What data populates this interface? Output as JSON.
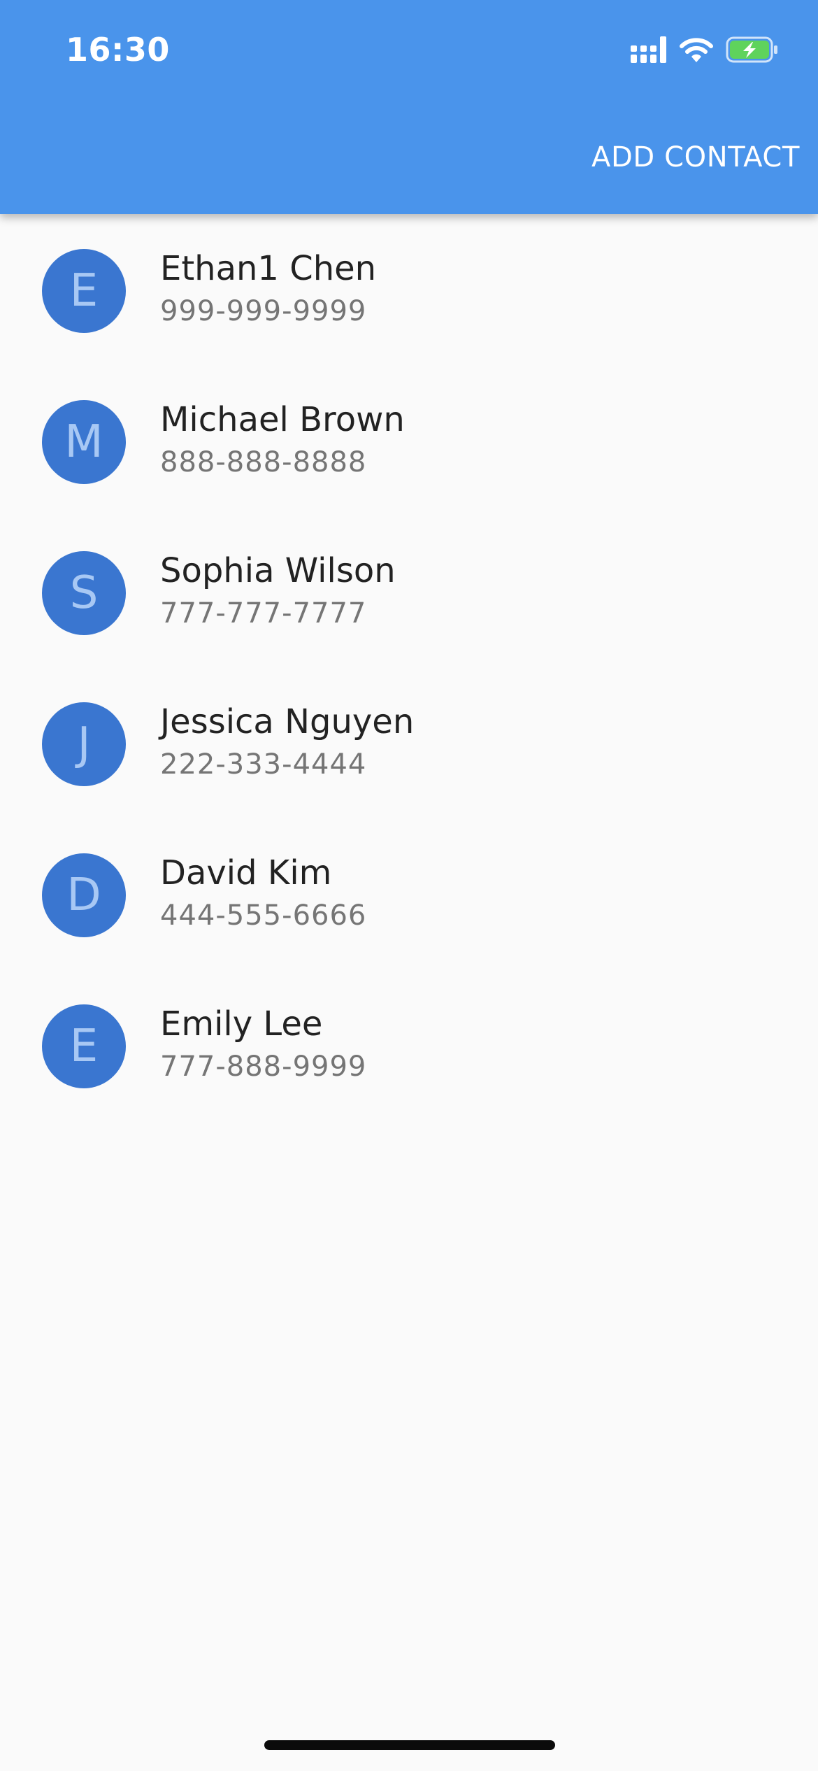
{
  "status_bar": {
    "time": "16:30",
    "icons": [
      "cellular-signal-icon",
      "wifi-icon",
      "battery-charging-icon"
    ]
  },
  "app_bar": {
    "action_label": "ADD CONTACT",
    "background_color": "#4a94eb"
  },
  "contacts": [
    {
      "initial": "E",
      "name": "Ethan1 Chen",
      "phone": "999-999-9999"
    },
    {
      "initial": "M",
      "name": "Michael Brown",
      "phone": "888-888-8888"
    },
    {
      "initial": "S",
      "name": "Sophia Wilson",
      "phone": "777-777-7777"
    },
    {
      "initial": "J",
      "name": "Jessica Nguyen",
      "phone": "222-333-4444"
    },
    {
      "initial": "D",
      "name": "David Kim",
      "phone": "444-555-6666"
    },
    {
      "initial": "E",
      "name": "Emily Lee",
      "phone": "777-888-9999"
    }
  ],
  "colors": {
    "avatar_background": "#3a76d0",
    "avatar_text": "#a8c8f4",
    "name_text": "#222222",
    "phone_text": "#757575",
    "battery_fill": "#5fd35c"
  }
}
